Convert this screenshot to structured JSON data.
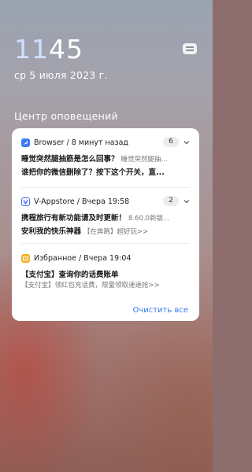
{
  "clock": {
    "hours": "11",
    "minutes": "45"
  },
  "date": "ср 5 июля 2023 г.",
  "notification_center": {
    "title": "Центр оповещений",
    "clear_all": "Очистить все",
    "notifications": [
      {
        "app": "Browser / 8 минут назад",
        "icon": "browser-app-icon",
        "count": "6",
        "line1_title": "睡觉突然腿抽筋是怎么回事？",
        "line1_rest": "睡觉突然腿抽...",
        "line2_title": "谁把你的微信删除了？按下这个开关，直...",
        "line2_rest": ""
      },
      {
        "app": "V-Appstore / Вчера 19:58",
        "icon": "v-appstore-app-icon",
        "count": "2",
        "line1_title": "携程旅行有新功能请及时更新！",
        "line1_rest": "8.60.0新版...",
        "line2_title": "安利我的快乐神器",
        "line2_rest": "【在奔跑】超好玩>>"
      },
      {
        "app": "Избранное / Вчера 19:04",
        "icon": "favorites-app-icon",
        "count": "",
        "line1_title": "【支付宝】查询你的话费账单",
        "line1_rest": "",
        "line2_title": "",
        "line2_rest": "【支付宝】领红包充话费，限量领取速速抢>>"
      }
    ]
  },
  "colors": {
    "accent": "#2f7cf6",
    "browser_icon": "#3b7cf5",
    "appstore_icon": "#3b6cf0",
    "favorites_icon": "#f2b01e"
  }
}
